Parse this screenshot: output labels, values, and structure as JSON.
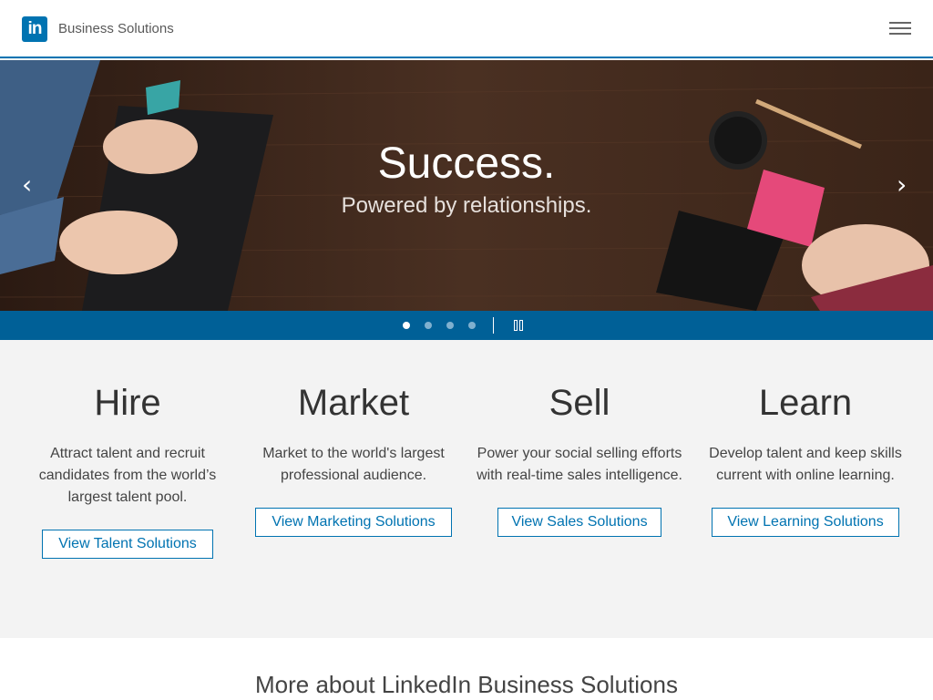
{
  "header": {
    "logo_text": "in",
    "brand": "Business Solutions",
    "menu_icon": "hamburger-menu-icon"
  },
  "hero": {
    "title": "Success.",
    "subtitle": "Powered by relationships.",
    "prev_arrow": "‹",
    "next_arrow": "›",
    "slide_count": 4,
    "active_slide": 1
  },
  "solutions": [
    {
      "title": "Hire",
      "description": "Attract talent and recruit candidates from the world’s largest talent pool.",
      "button": "View Talent Solutions"
    },
    {
      "title": "Market",
      "description": "Market to the world's largest professional audience.",
      "button": "View Marketing Solutions"
    },
    {
      "title": "Sell",
      "description": "Power your social selling efforts with real-time sales intelligence.",
      "button": "View Sales Solutions"
    },
    {
      "title": "Learn",
      "description": "Develop talent and keep skills current with online learning.",
      "button": "View Learning Solutions"
    }
  ],
  "more": {
    "heading": "More about LinkedIn Business Solutions"
  },
  "colors": {
    "brand_blue": "#0073b1",
    "carousel_bar": "#006097",
    "background": "#f3f3f3"
  }
}
